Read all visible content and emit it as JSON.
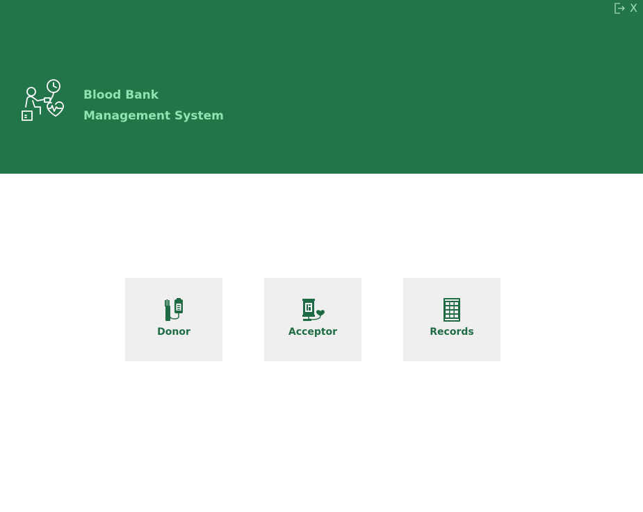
{
  "app": {
    "title_line1": "Blood Bank",
    "title_line2": "Management System"
  },
  "window": {
    "close_label": "X"
  },
  "icons": {
    "logo": "doctor-heart-monitor-icon",
    "logout": "logout-icon",
    "donor": "blood-donation-icon",
    "acceptor": "blood-acceptor-icon",
    "records": "records-cabinet-icon"
  },
  "tiles": [
    {
      "label": "Donor"
    },
    {
      "label": "Acceptor"
    },
    {
      "label": "Records"
    }
  ],
  "colors": {
    "header_bg": "#227548",
    "title_text": "#8ee3b0",
    "tile_bg": "#efefef",
    "tile_text": "#1f6b43"
  }
}
